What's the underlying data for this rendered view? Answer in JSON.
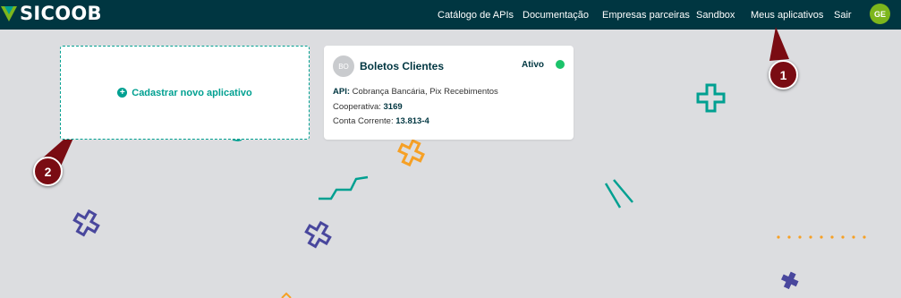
{
  "header": {
    "logo_text": "SICOOB",
    "nav": [
      {
        "label": "Catálogo de APIs"
      },
      {
        "label": "Documentação"
      },
      {
        "label": "Empresas parceiras"
      },
      {
        "label": "Sandbox"
      },
      {
        "label": "Meus aplicativos"
      },
      {
        "label": "Sair"
      }
    ],
    "user_initials": "GE"
  },
  "new_app": {
    "label": "Cadastrar novo aplicativo",
    "icon": "plus-circle-icon"
  },
  "app_card": {
    "initials": "BO",
    "title": "Boletos Clientes",
    "status": "Ativo",
    "api_label": "API:",
    "api_value": "Cobrança Bancária, Pix Recebimentos",
    "coop_label": "Cooperativa:",
    "coop_value": "3169",
    "account_label": "Conta Corrente:",
    "account_value": "13.813-4"
  },
  "markers": [
    {
      "label": "1"
    },
    {
      "label": "2"
    }
  ],
  "colors": {
    "header_bg": "#003641",
    "accent_teal": "#00a091",
    "status_green": "#1bc36a",
    "avatar_green": "#7db61c",
    "marker_red": "#7a0c13",
    "deco_orange": "#f6a025",
    "deco_purple": "#49479d"
  }
}
